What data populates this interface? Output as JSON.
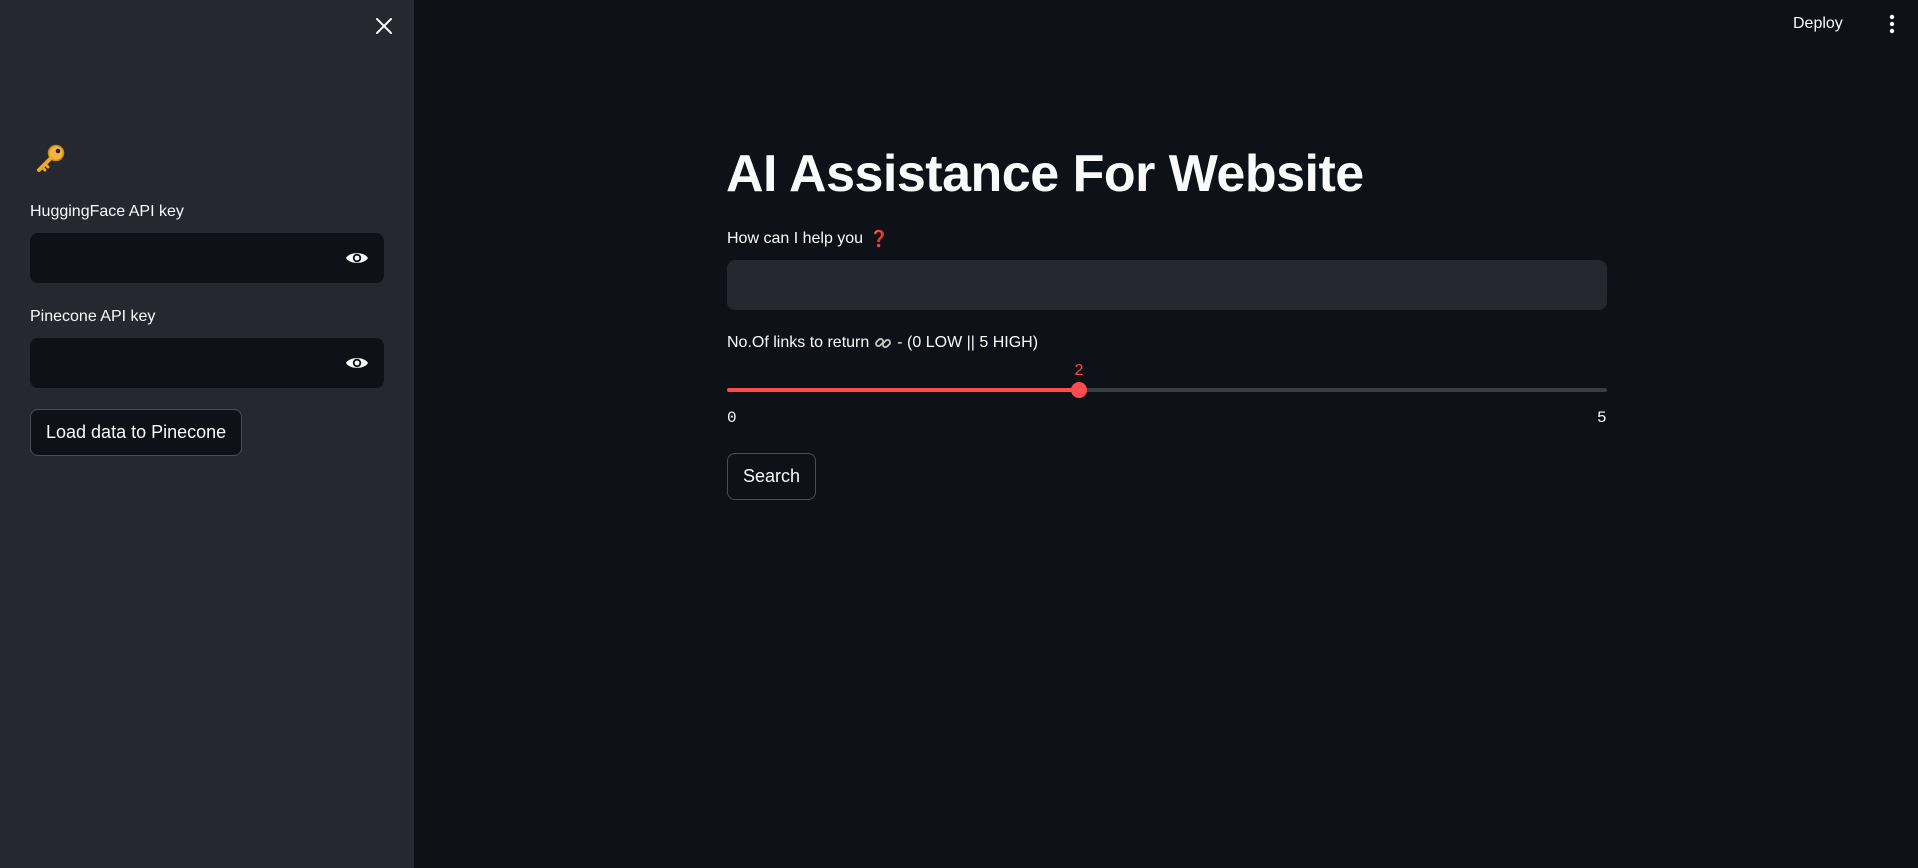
{
  "sidebar": {
    "key_icon": "key-icon",
    "huggingface": {
      "label": "HuggingFace API key",
      "value": "",
      "placeholder": ""
    },
    "pinecone": {
      "label": "Pinecone API key",
      "value": "",
      "placeholder": ""
    },
    "load_button_label": "Load data to Pinecone"
  },
  "header": {
    "deploy_label": "Deploy"
  },
  "main": {
    "title": "AI Assistance For Website",
    "question": {
      "label": "How can I help you",
      "icon": "question-mark-icon",
      "value": "",
      "placeholder": ""
    },
    "slider": {
      "label_prefix": "No.Of links to return",
      "label_suffix": "- (0 LOW || 5 HIGH)",
      "icon": "link-icon",
      "min": 0,
      "max": 5,
      "value": 2,
      "min_label": "0",
      "max_label": "5",
      "value_label": "2"
    },
    "search_label": "Search"
  },
  "colors": {
    "accent": "#ff4b4b",
    "background": "#0e1117",
    "sidebar": "#262730",
    "input": "#262730",
    "text": "#fafafa"
  }
}
